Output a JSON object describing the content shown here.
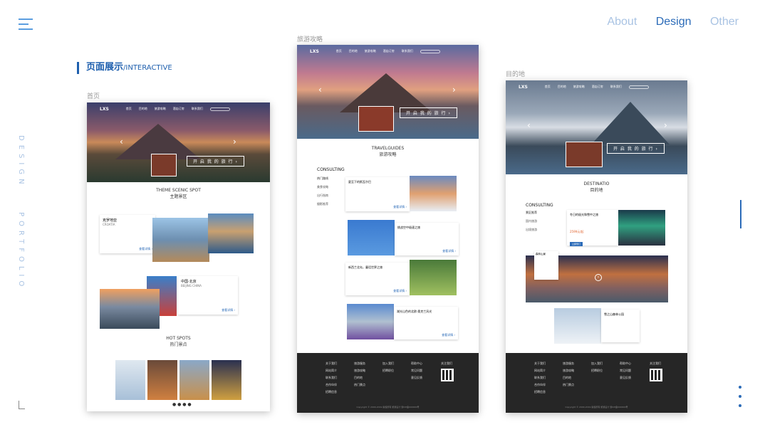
{
  "topnav": {
    "about": "About",
    "design": "Design",
    "other": "Other"
  },
  "vertical_text": [
    "DESIGN",
    "PORTFOLIO"
  ],
  "section": {
    "title": "页面展示",
    "subtitle": "/INTERACTIVE"
  },
  "labels": {
    "home": "首页",
    "travel": "旅游攻略",
    "destination": "目的地"
  },
  "site": {
    "logo": "LXS",
    "nav": [
      "首页",
      "目的地",
      "旅游攻略",
      "酒店订房",
      "联系我们"
    ],
    "cta": "开 启 我 的 旅 行 ›"
  },
  "home": {
    "theme_en": "THEME SCENIC SPOT",
    "theme_cn": "主题景区",
    "card1_title": "克罗地亚",
    "card1_sub": "CROATIA",
    "card2_title": "中国·北京",
    "card2_sub": "BEIJING CHINA",
    "hot_en": "HOT SPOTS",
    "hot_cn": "热门景点",
    "more": "查看详情 ›"
  },
  "travel": {
    "title_en": "TRAVELGUIDES",
    "title_cn": "旅游攻略",
    "consulting": "CONSULTING",
    "menu": [
      "热门路线",
      "美食攻略",
      "出行指南",
      "摄影推荐"
    ],
    "items": [
      "夏至下的斯瓦尔巴",
      "挑战空中极速之旅",
      "新西兰北岛，童话世界之旅",
      "湖光山色的北欧·奥克兰风光"
    ],
    "more": "查看详情 ›"
  },
  "dest": {
    "title_en": "DESTINATIO",
    "title_cn": "目的地",
    "consulting": "CONSULTING",
    "menu": [
      "景区推荐",
      "国内旅游",
      "出境旅游"
    ],
    "item1": "冬日的极光和雪中之旅",
    "price": "2599元/起",
    "btn": "立即预订",
    "item2": "森林山景",
    "item3": "雪之山森林公园"
  },
  "footer": {
    "cols": [
      {
        "head": "关于我们",
        "items": [
          "网站简介",
          "联系我们",
          "合作伙伴",
          "招聘信息"
        ]
      },
      {
        "head": "旅游服务",
        "items": [
          "旅游攻略",
          "目的地",
          "热门景点"
        ]
      },
      {
        "head": "加入我们",
        "items": [
          "招聘职位"
        ]
      },
      {
        "head": "帮助中心",
        "items": [
          "常见问题",
          "意见反馈"
        ]
      }
    ],
    "follow": "关注我们",
    "copyright": "Copyright © 2000-2019 版权所有 旅游设计 浙ICP备000000号"
  }
}
